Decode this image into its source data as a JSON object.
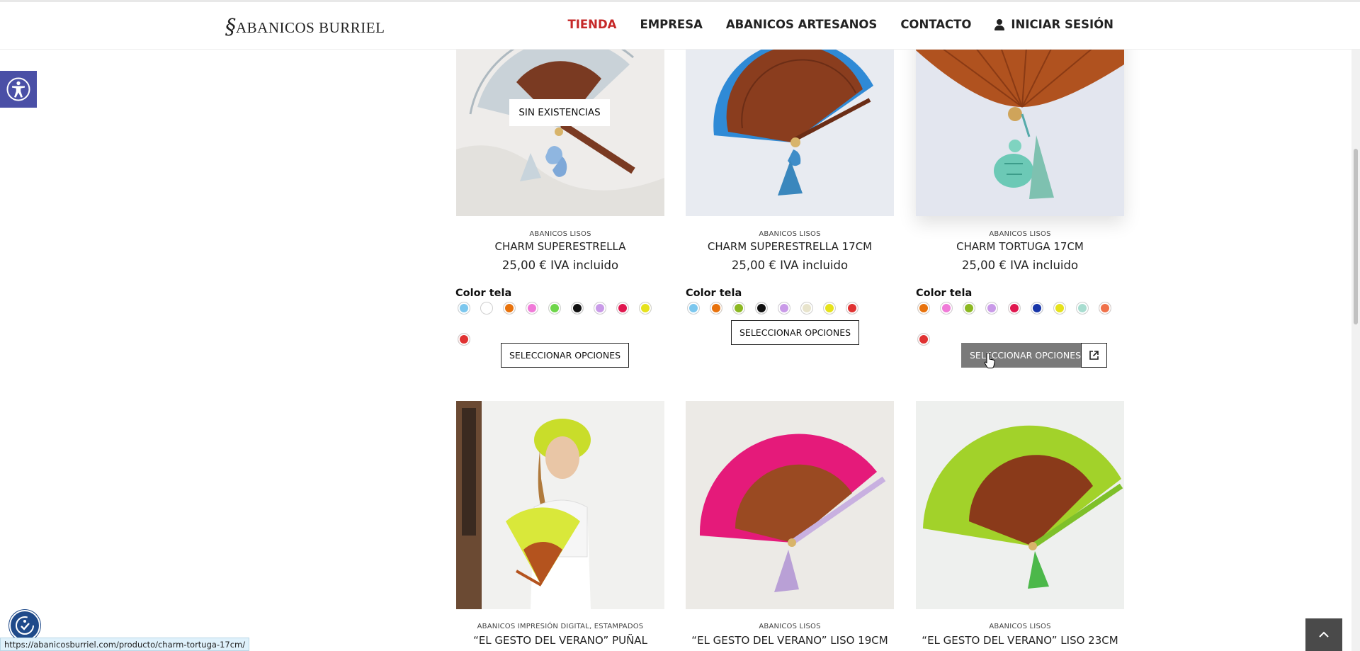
{
  "header": {
    "logo_text": "ABANICOS BURRIEL",
    "nav": [
      {
        "label": "TIENDA",
        "active": true
      },
      {
        "label": "EMPRESA",
        "active": false
      },
      {
        "label": "ABANICOS ARTESANOS",
        "active": false
      },
      {
        "label": "CONTACTO",
        "active": false
      }
    ],
    "login_label": "INICIAR SESIÓN"
  },
  "products": [
    {
      "category": "ABANICOS LISOS",
      "name": "CHARM SUPERESTRELLA",
      "price": "25,00 €",
      "tax_note": "IVA incluido",
      "badge": "SIN EXISTENCIAS",
      "swatch_label": "Color tela",
      "swatches": [
        "#7cc7ee",
        "#ffffff",
        "#e8720c",
        "#f07ad8",
        "#6ed64a",
        "#111111",
        "#c99ae8",
        "#e0174f",
        "#e6e21c",
        "#e03232"
      ],
      "button_label": "SELECCIONAR OPCIONES"
    },
    {
      "category": "ABANICOS LISOS",
      "name": "CHARM SUPERESTRELLA 17CM",
      "price": "25,00 €",
      "tax_note": "IVA incluido",
      "swatch_label": "Color tela",
      "swatches": [
        "#7cc7ee",
        "#e8720c",
        "#8cb822",
        "#111111",
        "#c99ae8",
        "#e8e4cc",
        "#e6e21c",
        "#e03232"
      ],
      "button_label": "SELECCIONAR OPCIONES"
    },
    {
      "category": "ABANICOS LISOS",
      "name": "CHARM TORTUGA 17CM",
      "price": "25,00 €",
      "tax_note": "IVA incluido",
      "swatch_label": "Color tela",
      "swatches": [
        "#e8720c",
        "#f07ad8",
        "#8cb822",
        "#c99ae8",
        "#e0174f",
        "#1735a8",
        "#e6e21c",
        "#a8ddd0",
        "#f0714a",
        "#e03232"
      ],
      "button_label": "SELECCIONAR OPCIONES"
    },
    {
      "category": "ABANICOS IMPRESIÓN DIGITAL, ESTAMPADOS",
      "name": "“EL GESTO DEL VERANO” PUÑAL"
    },
    {
      "category": "ABANICOS LISOS",
      "name": "“EL GESTO DEL VERANO” LISO 19CM"
    },
    {
      "category": "ABANICOS LISOS",
      "name": "“EL GESTO DEL VERANO” LISO 23CM"
    }
  ],
  "status_url": "https://abanicosburriel.com/producto/charm-tortuga-17cm/",
  "icons": {
    "a11y": "accessibility-person-icon",
    "float": "accessibility-check-icon",
    "top": "chevron-up-icon",
    "external": "external-link-icon",
    "user": "user-icon"
  },
  "colors": {
    "accent_active": "#c62828",
    "a11y_button": "#4a4fa6",
    "hover_button": "#7a7a7a"
  }
}
